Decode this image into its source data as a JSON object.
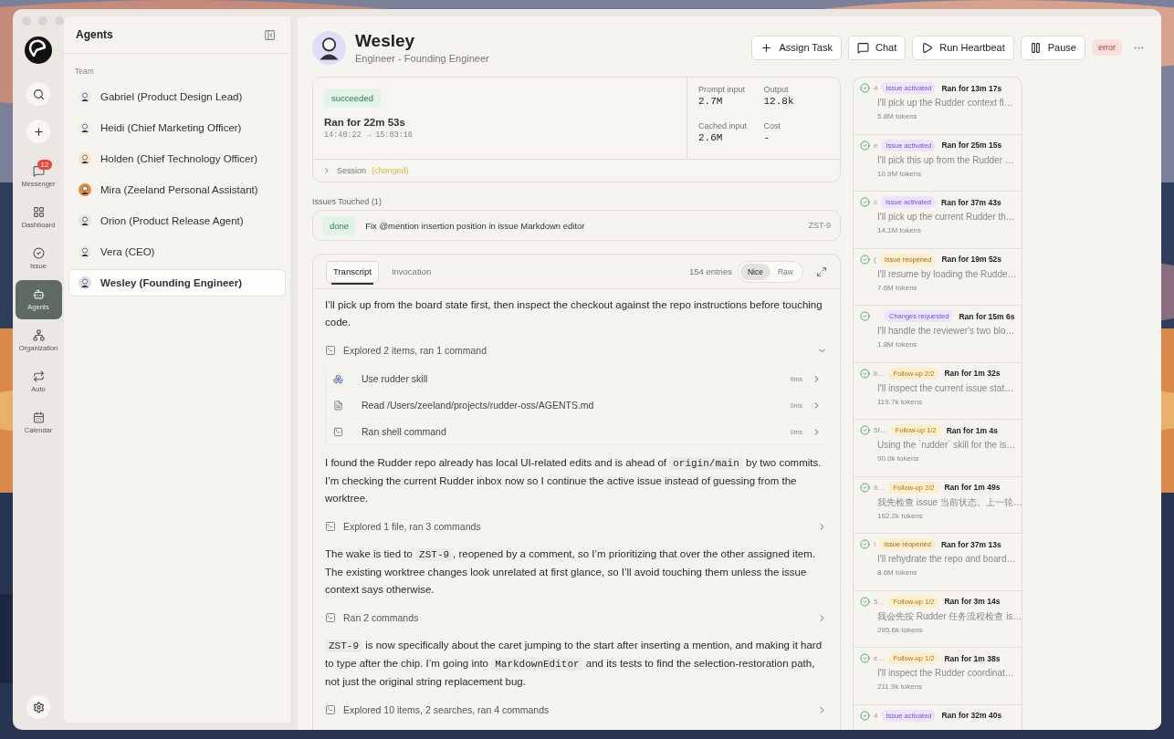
{
  "rail": {
    "items": [
      {
        "label": "Messenger",
        "badge": "12",
        "selected": false
      },
      {
        "label": "Dashboard",
        "selected": false
      },
      {
        "label": "Issue",
        "selected": false
      },
      {
        "label": "Agents",
        "selected": true
      },
      {
        "label": "Organization",
        "selected": false
      },
      {
        "label": "Auto",
        "selected": false
      },
      {
        "label": "Calendar",
        "selected": false
      }
    ]
  },
  "sidebar": {
    "title": "Agents",
    "section": "Team",
    "items": [
      {
        "label": "Gabriel (Product Design Lead)",
        "selected": false
      },
      {
        "label": "Heidi (Chief Marketing Officer)",
        "selected": false
      },
      {
        "label": "Holden (Chief Technology Officer)",
        "selected": false
      },
      {
        "label": "Mira (Zeeland Personal Assistant)",
        "selected": false
      },
      {
        "label": "Orion (Product Release Agent)",
        "selected": false
      },
      {
        "label": "Vera (CEO)",
        "selected": false
      },
      {
        "label": "Wesley (Founding Engineer)",
        "selected": true
      }
    ]
  },
  "agent": {
    "name": "Wesley",
    "role": "Engineer - Founding Engineer",
    "status": "error"
  },
  "actions": [
    "Assign Task",
    "Chat",
    "Run Heartbeat",
    "Pause"
  ],
  "run": {
    "status": "succeeded",
    "duration": "Ran for 22m 53s",
    "time_start": "14:40:22",
    "arrow": "→",
    "time_end": "15:03:16",
    "stats": [
      {
        "label": "Prompt input",
        "value": "2.7M"
      },
      {
        "label": "Output",
        "value": "12.8k"
      },
      {
        "label": "Cached input",
        "value": "2.6M"
      },
      {
        "label": "Cost",
        "value": "-"
      }
    ],
    "session": {
      "label": "Session",
      "note": "(changed)",
      "expanded": false
    }
  },
  "issues_touched": {
    "title": "Issues Touched (1)",
    "items": [
      {
        "status": "done",
        "title": "Fix @mention insertion position in issue Markdown editor",
        "key": "ZST-9"
      }
    ]
  },
  "transcript": {
    "tabs": [
      {
        "label": "Transcript",
        "selected": true
      },
      {
        "label": "Invocation",
        "selected": false
      }
    ],
    "entries_count": "154 entries",
    "modes": [
      {
        "label": "Nice",
        "selected": true
      },
      {
        "label": "Raw",
        "selected": false
      }
    ],
    "blocks": [
      {
        "kind": "text",
        "segments": [
          {
            "kind": "text",
            "text": "I’ll pick up from the board state first, then inspect the checkout against the repo instructions before touching code."
          }
        ]
      },
      {
        "kind": "group",
        "label": "Explored 2 items, ran 1 command",
        "expanded": true,
        "children": [
          {
            "kind": "skill",
            "label": "Use rudder skill",
            "time": "0ms"
          },
          {
            "kind": "file",
            "label": "Read /Users/zeeland/projects/rudder-oss/AGENTS.md",
            "time": "0ms"
          },
          {
            "kind": "shell",
            "label": "Ran shell command",
            "time": "0ms"
          }
        ]
      },
      {
        "kind": "text",
        "segments": [
          {
            "kind": "text",
            "text": "I found the Rudder repo already has local UI-related edits and is ahead of "
          },
          {
            "kind": "code",
            "text": "origin/main"
          },
          {
            "kind": "text",
            "text": " by two commits. I’m checking the current Rudder inbox now so I continue the active issue instead of guessing from the worktree."
          }
        ]
      },
      {
        "kind": "group",
        "label": "Explored 1 file, ran 3 commands",
        "expanded": false
      },
      {
        "kind": "text",
        "segments": [
          {
            "kind": "text",
            "text": "The wake is tied to "
          },
          {
            "kind": "code",
            "text": "ZST-9"
          },
          {
            "kind": "text",
            "text": ", reopened by a comment, so I’m prioritizing that over the other assigned item. The existing worktree changes look unrelated at first glance, so I’ll avoid touching them unless the issue context says otherwise."
          }
        ]
      },
      {
        "kind": "group",
        "label": "Ran 2 commands",
        "expanded": false
      },
      {
        "kind": "text",
        "segments": [
          {
            "kind": "code",
            "text": "ZST-9"
          },
          {
            "kind": "text",
            "text": " is now specifically about the caret jumping to the start after inserting a mention, and making it hard to type after the chip. I’m going into "
          },
          {
            "kind": "code",
            "text": "MarkdownEditor"
          },
          {
            "kind": "text",
            "text": " and its tests to find the selection-restoration path, not just the original string replacement bug."
          }
        ]
      },
      {
        "kind": "group",
        "label": "Explored 10 items, 2 searches, ran 4 commands",
        "expanded": false
      }
    ]
  },
  "runs": [
    {
      "id": "4",
      "kind": "activated",
      "badge": "Issue activated",
      "duration": "Ran for 13m 17s",
      "preview": "I'll pick up the Rudder context fi…",
      "tokens": "5.8M tokens"
    },
    {
      "id": "e",
      "kind": "activated",
      "badge": "Issue activated",
      "duration": "Ran for 25m 15s",
      "preview": "I'll pick this up from the Rudder …",
      "tokens": "10.9M tokens"
    },
    {
      "id": "c",
      "kind": "activated",
      "badge": "Issue activated",
      "duration": "Ran for 37m 43s",
      "preview": "I'll pick up the current Rudder th…",
      "tokens": "14.1M tokens"
    },
    {
      "id": "(",
      "kind": "reopened",
      "badge": "Issue reopened",
      "duration": "Ran for 19m 52s",
      "preview": "I'll resume by loading the Rudde…",
      "tokens": "7.6M tokens"
    },
    {
      "kind": "changes",
      "badge": "Changes requested",
      "duration": "Ran for 15m 6s",
      "preview": "I'll handle the reviewer's two blo…",
      "tokens": "1.8M tokens"
    },
    {
      "id": "b…",
      "kind": "followup",
      "badge": "Follow-up 2/2",
      "duration": "Ran for 1m 32s",
      "preview": "I'll inspect the current issue stat…",
      "tokens": "119.7k tokens"
    },
    {
      "id": "5f…",
      "kind": "followup",
      "badge": "Follow-up 1/2",
      "duration": "Ran for 1m 4s",
      "preview": "Using the `rudder` skill for the is…",
      "tokens": "90.0k tokens"
    },
    {
      "id": "9…",
      "kind": "followup",
      "badge": "Follow-up 2/2",
      "duration": "Ran for 1m 49s",
      "preview": "我先检查 issue 当前状态、上一轮…",
      "tokens": "162.2k tokens"
    },
    {
      "id": "!",
      "kind": "reopened",
      "badge": "Issue reopened",
      "duration": "Ran for 37m 13s",
      "preview": "I'll rehydrate the repo and board…",
      "tokens": "8.6M tokens"
    },
    {
      "id": "5…",
      "kind": "followup",
      "badge": "Follow-up 1/2",
      "duration": "Ran for 3m 14s",
      "preview": "我会先按 Rudder 任务流程检查 is…",
      "tokens": "295.6k tokens"
    },
    {
      "id": "e…",
      "kind": "followup",
      "badge": "Follow-up 1/2",
      "duration": "Ran for 1m 38s",
      "preview": "I'll inspect the Rudder coordinat…",
      "tokens": "211.9k tokens"
    },
    {
      "id": "4",
      "kind": "activated",
      "badge": "Issue activated",
      "duration": "Ran for 32m 40s"
    }
  ]
}
